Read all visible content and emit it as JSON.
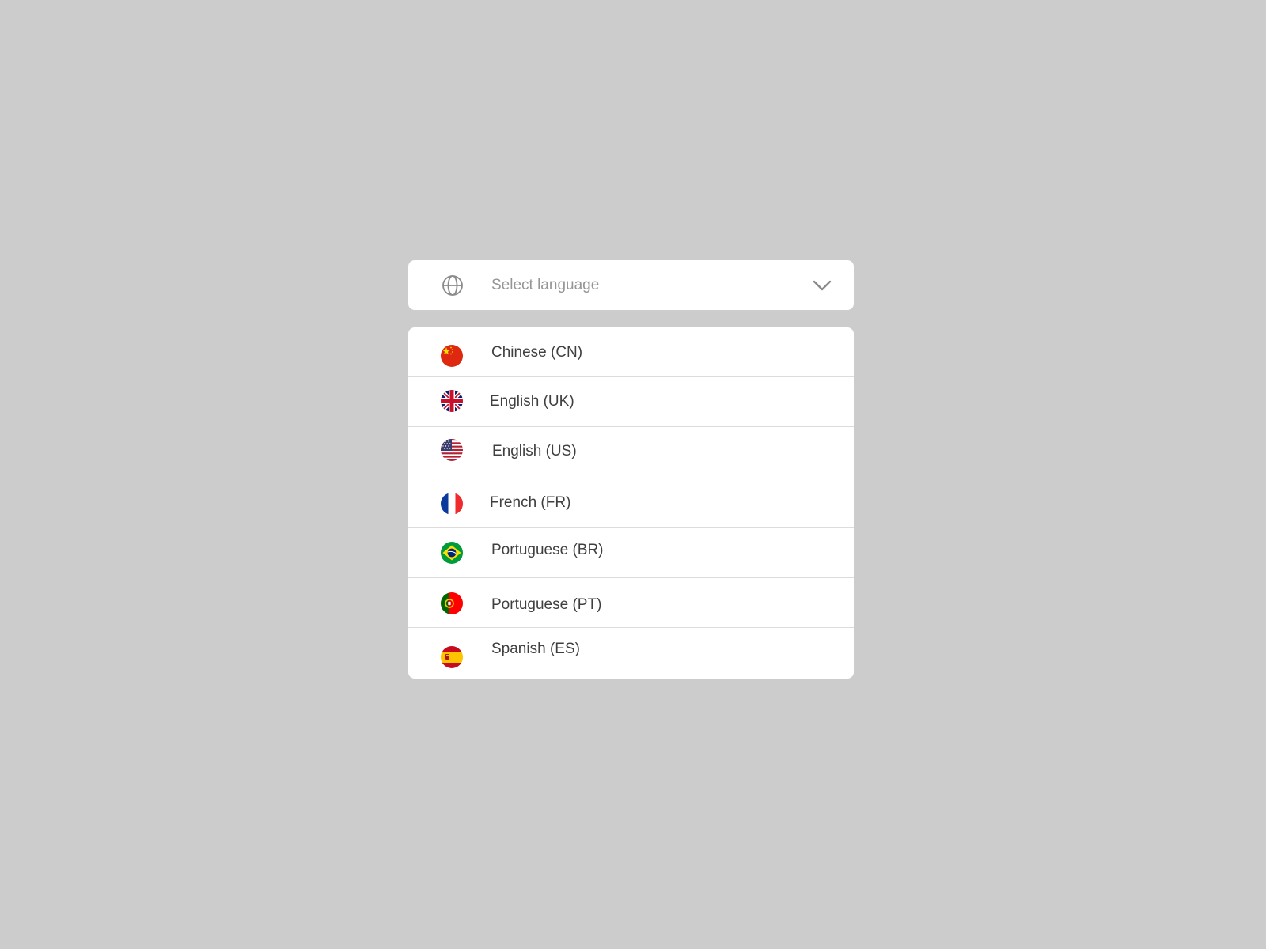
{
  "select": {
    "placeholder": "Select language",
    "icon": "globe-icon",
    "chevron": "chevron-down-icon"
  },
  "languages": [
    {
      "label": "Chinese (CN)",
      "flag": "china-flag-icon"
    },
    {
      "label": "English (UK)",
      "flag": "uk-flag-icon"
    },
    {
      "label": "English (US)",
      "flag": "us-flag-icon"
    },
    {
      "label": "French (FR)",
      "flag": "france-flag-icon"
    },
    {
      "label": "Portuguese (BR)",
      "flag": "brazil-flag-icon"
    },
    {
      "label": "Portuguese (PT)",
      "flag": "portugal-flag-icon"
    },
    {
      "label": "Spanish (ES)",
      "flag": "spain-flag-icon"
    }
  ],
  "colors": {
    "background": "#cccccc",
    "panel": "#ffffff",
    "placeholder_text": "#959595",
    "option_text": "#3f3f3f",
    "divider": "#dcdcdc"
  }
}
